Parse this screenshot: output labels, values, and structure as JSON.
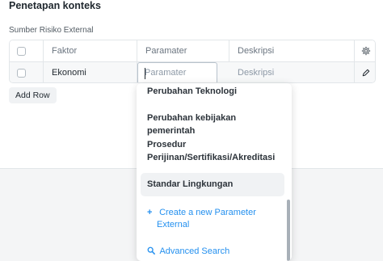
{
  "section": {
    "title": "Penetapan konteks"
  },
  "field": {
    "label": "Sumber Risiko External"
  },
  "grid": {
    "columns": [
      "Faktor",
      "Paramater",
      "Deskripsi"
    ],
    "row": {
      "faktor": "Ekonomi",
      "param_placeholder": "Paramater",
      "desk_placeholder": "Deskripsi"
    }
  },
  "buttons": {
    "add_row": "Add Row"
  },
  "dropdown": {
    "items": [
      "Perubahan Teknologi",
      "Perubahan kebijakan pemerintah",
      "Prosedur",
      "Perijinan/Sertifikasi/Akreditasi",
      "Standar Lingkungan"
    ],
    "create_label_line1": "Create a new Parameter",
    "create_label_line2": "External",
    "advanced_search": "Advanced Search"
  },
  "icons": {
    "settings": "gear-icon",
    "edit": "pencil-icon",
    "plus": "plus-icon",
    "search": "search-icon"
  },
  "colors": {
    "link": "#2490ef",
    "text": "#1f272e"
  }
}
